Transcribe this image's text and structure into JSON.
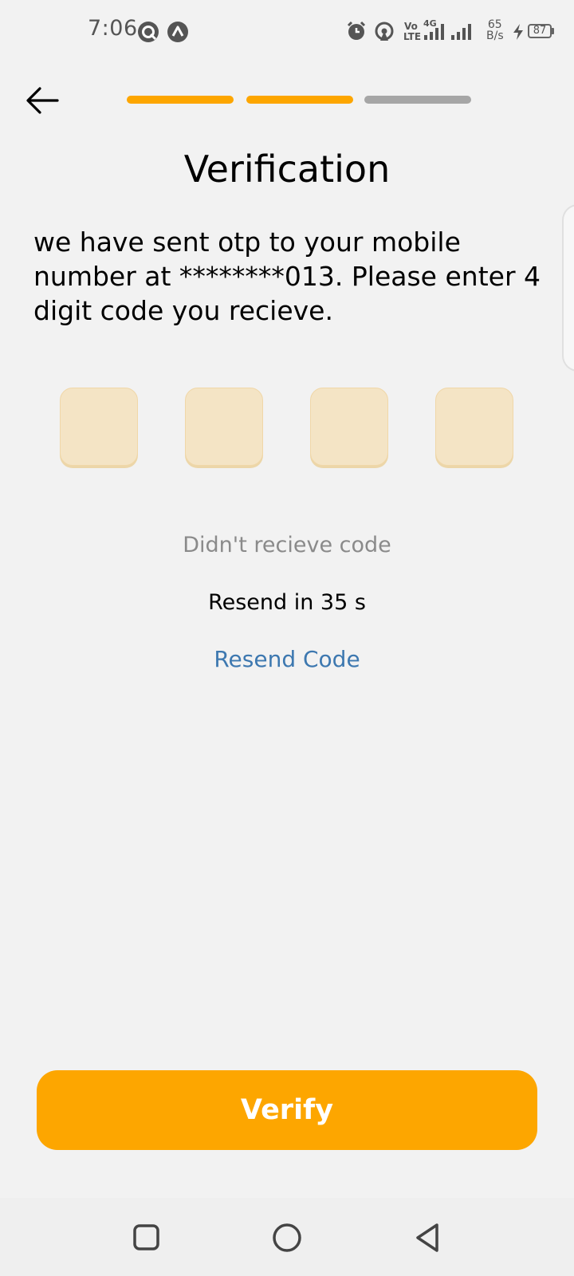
{
  "status_bar": {
    "time": "7:06",
    "network_label_top": "Vo",
    "network_label_bottom": "LTE",
    "network_type": "4G",
    "speed_value": "65",
    "speed_unit": "B/s",
    "battery": "87",
    "icons": [
      "vpn-icon",
      "app-notification-icon",
      "alarm-icon",
      "hotspot-icon",
      "signal-icon",
      "signal-icon-2",
      "charging-icon"
    ]
  },
  "header": {
    "back_icon": "arrow-left-icon",
    "progress_steps": [
      {
        "state": "complete"
      },
      {
        "state": "complete"
      },
      {
        "state": "incomplete"
      }
    ]
  },
  "main": {
    "title": "Verification",
    "description": "we have sent otp to your mobile number at ********013. Please enter 4 digit code you recieve.",
    "otp_boxes": [
      "",
      "",
      "",
      ""
    ],
    "didnt_receive": "Didn't recieve code",
    "resend_timer": "Resend in 35 s",
    "resend_link": "Resend Code",
    "verify_button": "Verify"
  },
  "nav_bar": {
    "icons": [
      "recent-apps-icon",
      "home-icon",
      "back-icon"
    ]
  },
  "colors": {
    "accent": "#fda600",
    "progress_inactive": "#a6a6a6",
    "otp_fill": "#f4e4c5",
    "link": "#3d78b0",
    "muted_text": "#8a8a8a",
    "background": "#f2f2f2"
  }
}
